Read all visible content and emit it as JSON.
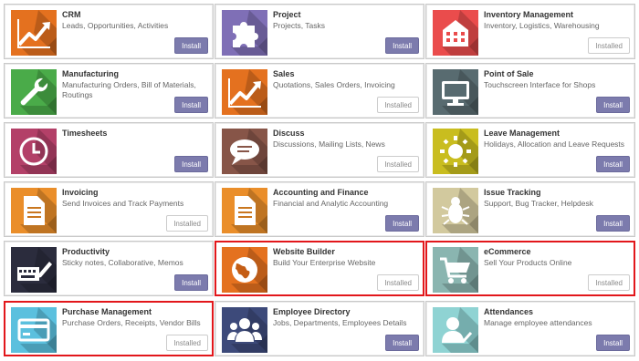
{
  "apps": [
    {
      "name": "CRM",
      "desc": "Leads, Opportunities, Activities",
      "button": "Install",
      "icon": "chart-trend-icon",
      "color": "#e4711f"
    },
    {
      "name": "Project",
      "desc": "Projects, Tasks",
      "button": "Install",
      "icon": "puzzle-icon",
      "color": "#7f6fb6"
    },
    {
      "name": "Inventory Management",
      "desc": "Inventory, Logistics, Warehousing",
      "button": "Installed",
      "icon": "warehouse-icon",
      "color": "#ea4c4c"
    },
    {
      "name": "Manufacturing",
      "desc": "Manufacturing Orders, Bill of Materials, Routings",
      "button": "Install",
      "icon": "wrench-icon",
      "color": "#4aab49"
    },
    {
      "name": "Sales",
      "desc": "Quotations, Sales Orders, Invoicing",
      "button": "Installed",
      "icon": "chart-trend-icon",
      "color": "#e4711f"
    },
    {
      "name": "Point of Sale",
      "desc": "Touchscreen Interface for Shops",
      "button": "Install",
      "icon": "monitor-icon",
      "color": "#586b70"
    },
    {
      "name": "Timesheets",
      "desc": "",
      "button": "Install",
      "icon": "clock-icon",
      "color": "#b34068"
    },
    {
      "name": "Discuss",
      "desc": "Discussions, Mailing Lists, News",
      "button": "Installed",
      "icon": "chat-bubble-icon",
      "color": "#875548"
    },
    {
      "name": "Leave Management",
      "desc": "Holidays, Allocation and Leave Requests",
      "button": "Install",
      "icon": "sun-icon",
      "color": "#c9bd1f"
    },
    {
      "name": "Invoicing",
      "desc": "Send Invoices and Track Payments",
      "button": "Installed",
      "icon": "document-icon",
      "color": "#ea8e2a"
    },
    {
      "name": "Accounting and Finance",
      "desc": "Financial and Analytic Accounting",
      "button": "Install",
      "icon": "document-icon",
      "color": "#ea8e2a"
    },
    {
      "name": "Issue Tracking",
      "desc": "Support, Bug Tracker, Helpdesk",
      "button": "Install",
      "icon": "bug-icon",
      "color": "#d2c99e"
    },
    {
      "name": "Productivity",
      "desc": "Sticky notes, Collaborative, Memos",
      "button": "Install",
      "icon": "keyboard-pencil-icon",
      "color": "#2b2c3d"
    },
    {
      "name": "Website Builder",
      "desc": "Build Your Enterprise Website",
      "button": "Installed",
      "icon": "globe-icon",
      "color": "#e4711f"
    },
    {
      "name": "eCommerce",
      "desc": "Sell Your Products Online",
      "button": "Installed",
      "icon": "cart-icon",
      "color": "#8ab5b0"
    },
    {
      "name": "Purchase Management",
      "desc": "Purchase Orders, Receipts, Vendor Bills",
      "button": "Installed",
      "icon": "credit-card-icon",
      "color": "#5bc0de"
    },
    {
      "name": "Employee Directory",
      "desc": "Jobs, Departments, Employees Details",
      "button": "Install",
      "icon": "people-icon",
      "color": "#3d4a7a"
    },
    {
      "name": "Attendances",
      "desc": "Manage employee attendances",
      "button": "Install",
      "icon": "user-check-icon",
      "color": "#8fd3d3"
    }
  ]
}
